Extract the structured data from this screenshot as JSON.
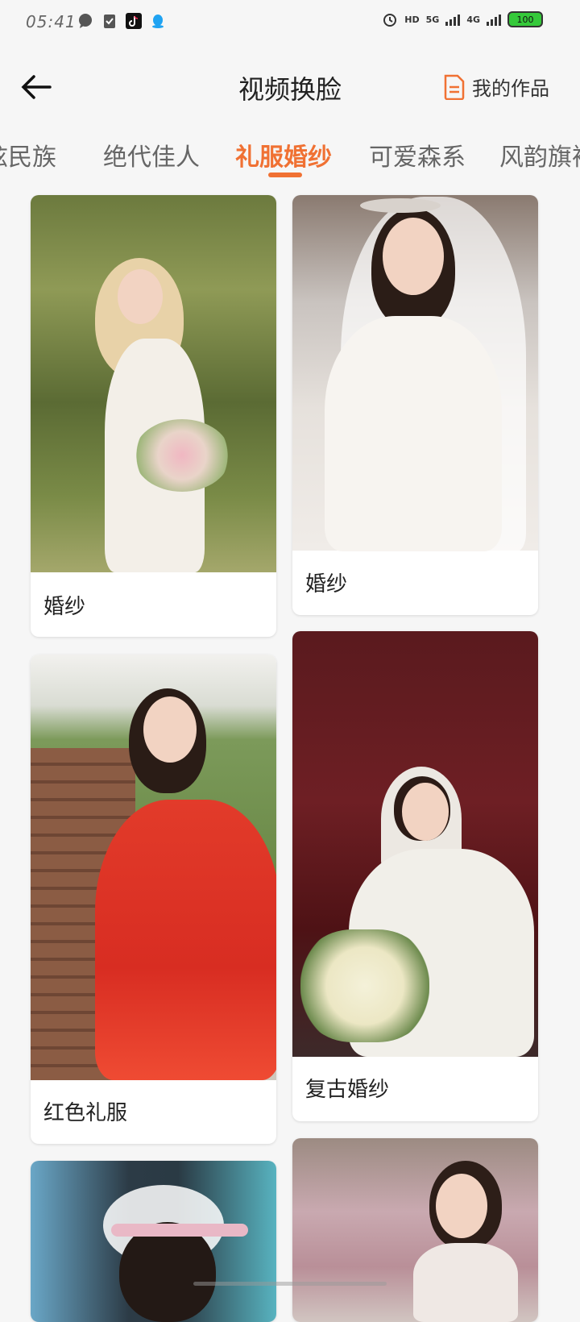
{
  "status_bar": {
    "time": "05:41",
    "network_hd": "HD",
    "network_5g": "5G",
    "network_4g": "4G",
    "battery": "100"
  },
  "header": {
    "title": "视频换脸",
    "my_works_label": "我的作品"
  },
  "tabs": [
    {
      "label": "炫民族"
    },
    {
      "label": "绝代佳人"
    },
    {
      "label": "礼服婚纱",
      "active": true
    },
    {
      "label": "可爱森系"
    },
    {
      "label": "风韵旗袍"
    }
  ],
  "cards": [
    {
      "label": "婚纱"
    },
    {
      "label": "婚纱"
    },
    {
      "label": "红色礼服"
    },
    {
      "label": "复古婚纱"
    },
    {
      "label": ""
    },
    {
      "label": ""
    }
  ],
  "colors": {
    "accent": "#f07133",
    "battery": "#35c93a"
  }
}
